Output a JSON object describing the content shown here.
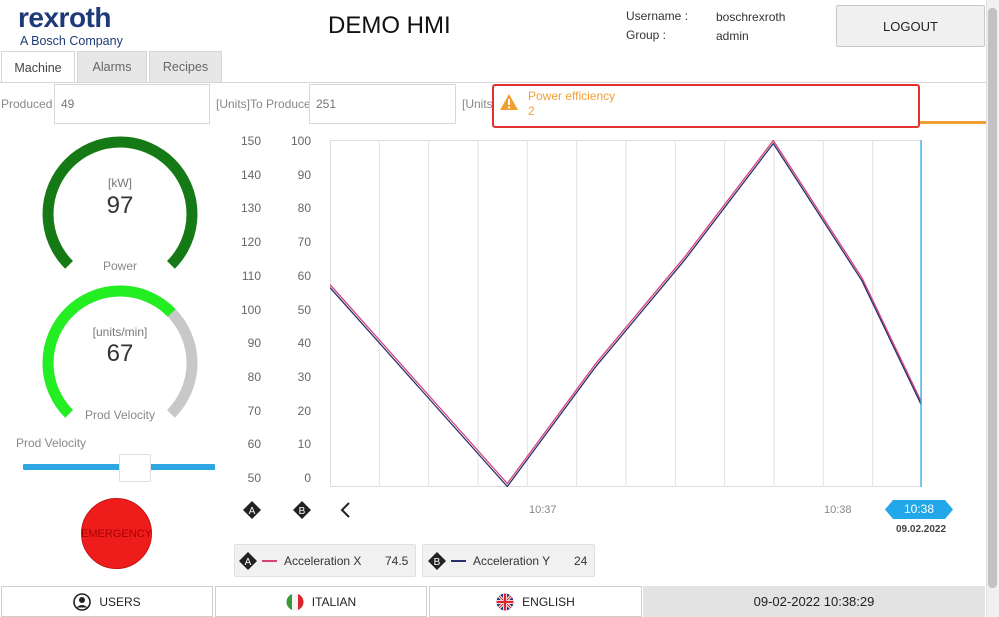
{
  "brand": {
    "name": "rexroth",
    "tagline": "A Bosch Company"
  },
  "header": {
    "title": "DEMO HMI",
    "username_label": "Username :",
    "username": "boschrexroth",
    "group_label": "Group :",
    "group": "admin",
    "logout_label": "LOGOUT"
  },
  "tabs": [
    {
      "label": "Machine",
      "active": true
    },
    {
      "label": "Alarms",
      "active": false
    },
    {
      "label": "Recipes",
      "active": false
    }
  ],
  "production": {
    "produced_label": "Produced",
    "produced_value": "49",
    "to_produce_label": "[Units]To Produce",
    "to_produce_value": "251",
    "third_label": "[Units"
  },
  "alarm": {
    "title": "Power efficiency",
    "value": "2",
    "color": "#f0a030",
    "icon": "warning-icon"
  },
  "gauges": {
    "power": {
      "unit": "[kW]",
      "value": "97",
      "label": "Power",
      "fraction": 1.0,
      "color": "#157a15"
    },
    "velocity": {
      "unit": "[units/min]",
      "value": "67",
      "label": "Prod Velocity",
      "fraction": 0.67,
      "color": "#22ee22",
      "track_color": "#c8c8c8"
    }
  },
  "slider": {
    "label": "Prod Velocity",
    "value_fraction": 0.6
  },
  "emergency": {
    "label": "EMERGENCY"
  },
  "chart_data": {
    "type": "line",
    "y_axes": [
      {
        "ticks": [
          "150",
          "140",
          "130",
          "120",
          "110",
          "100",
          "90",
          "80",
          "70",
          "60",
          "50"
        ],
        "range": [
          50,
          150
        ]
      },
      {
        "ticks": [
          "100",
          "90",
          "80",
          "70",
          "60",
          "50",
          "40",
          "30",
          "20",
          "10",
          "0"
        ],
        "range": [
          0,
          100
        ]
      }
    ],
    "x_tick_labels": [
      "10:37",
      "10:38"
    ],
    "current_time": "10:38",
    "current_date": "09.02.2022",
    "grid": true,
    "series": [
      {
        "name": "Acceleration X",
        "marker": "A",
        "color": "#d8407a",
        "current": "74.5",
        "x": [
          0,
          0.15,
          0.3,
          0.45,
          0.6,
          0.75,
          0.9,
          1.0
        ],
        "y": [
          58,
          29,
          0,
          35,
          66,
          100,
          60,
          24
        ]
      },
      {
        "name": "Acceleration Y",
        "marker": "B",
        "color": "#26306a",
        "current": "24",
        "x": [
          0,
          0.15,
          0.3,
          0.45,
          0.6,
          0.75,
          0.9,
          1.0
        ],
        "y": [
          58,
          29,
          0,
          35,
          66,
          100,
          60,
          24
        ]
      }
    ]
  },
  "footer": {
    "users_label": "USERS",
    "italian_label": "ITALIAN",
    "english_label": "ENGLISH",
    "datetime": "09-02-2022 10:38:29"
  }
}
